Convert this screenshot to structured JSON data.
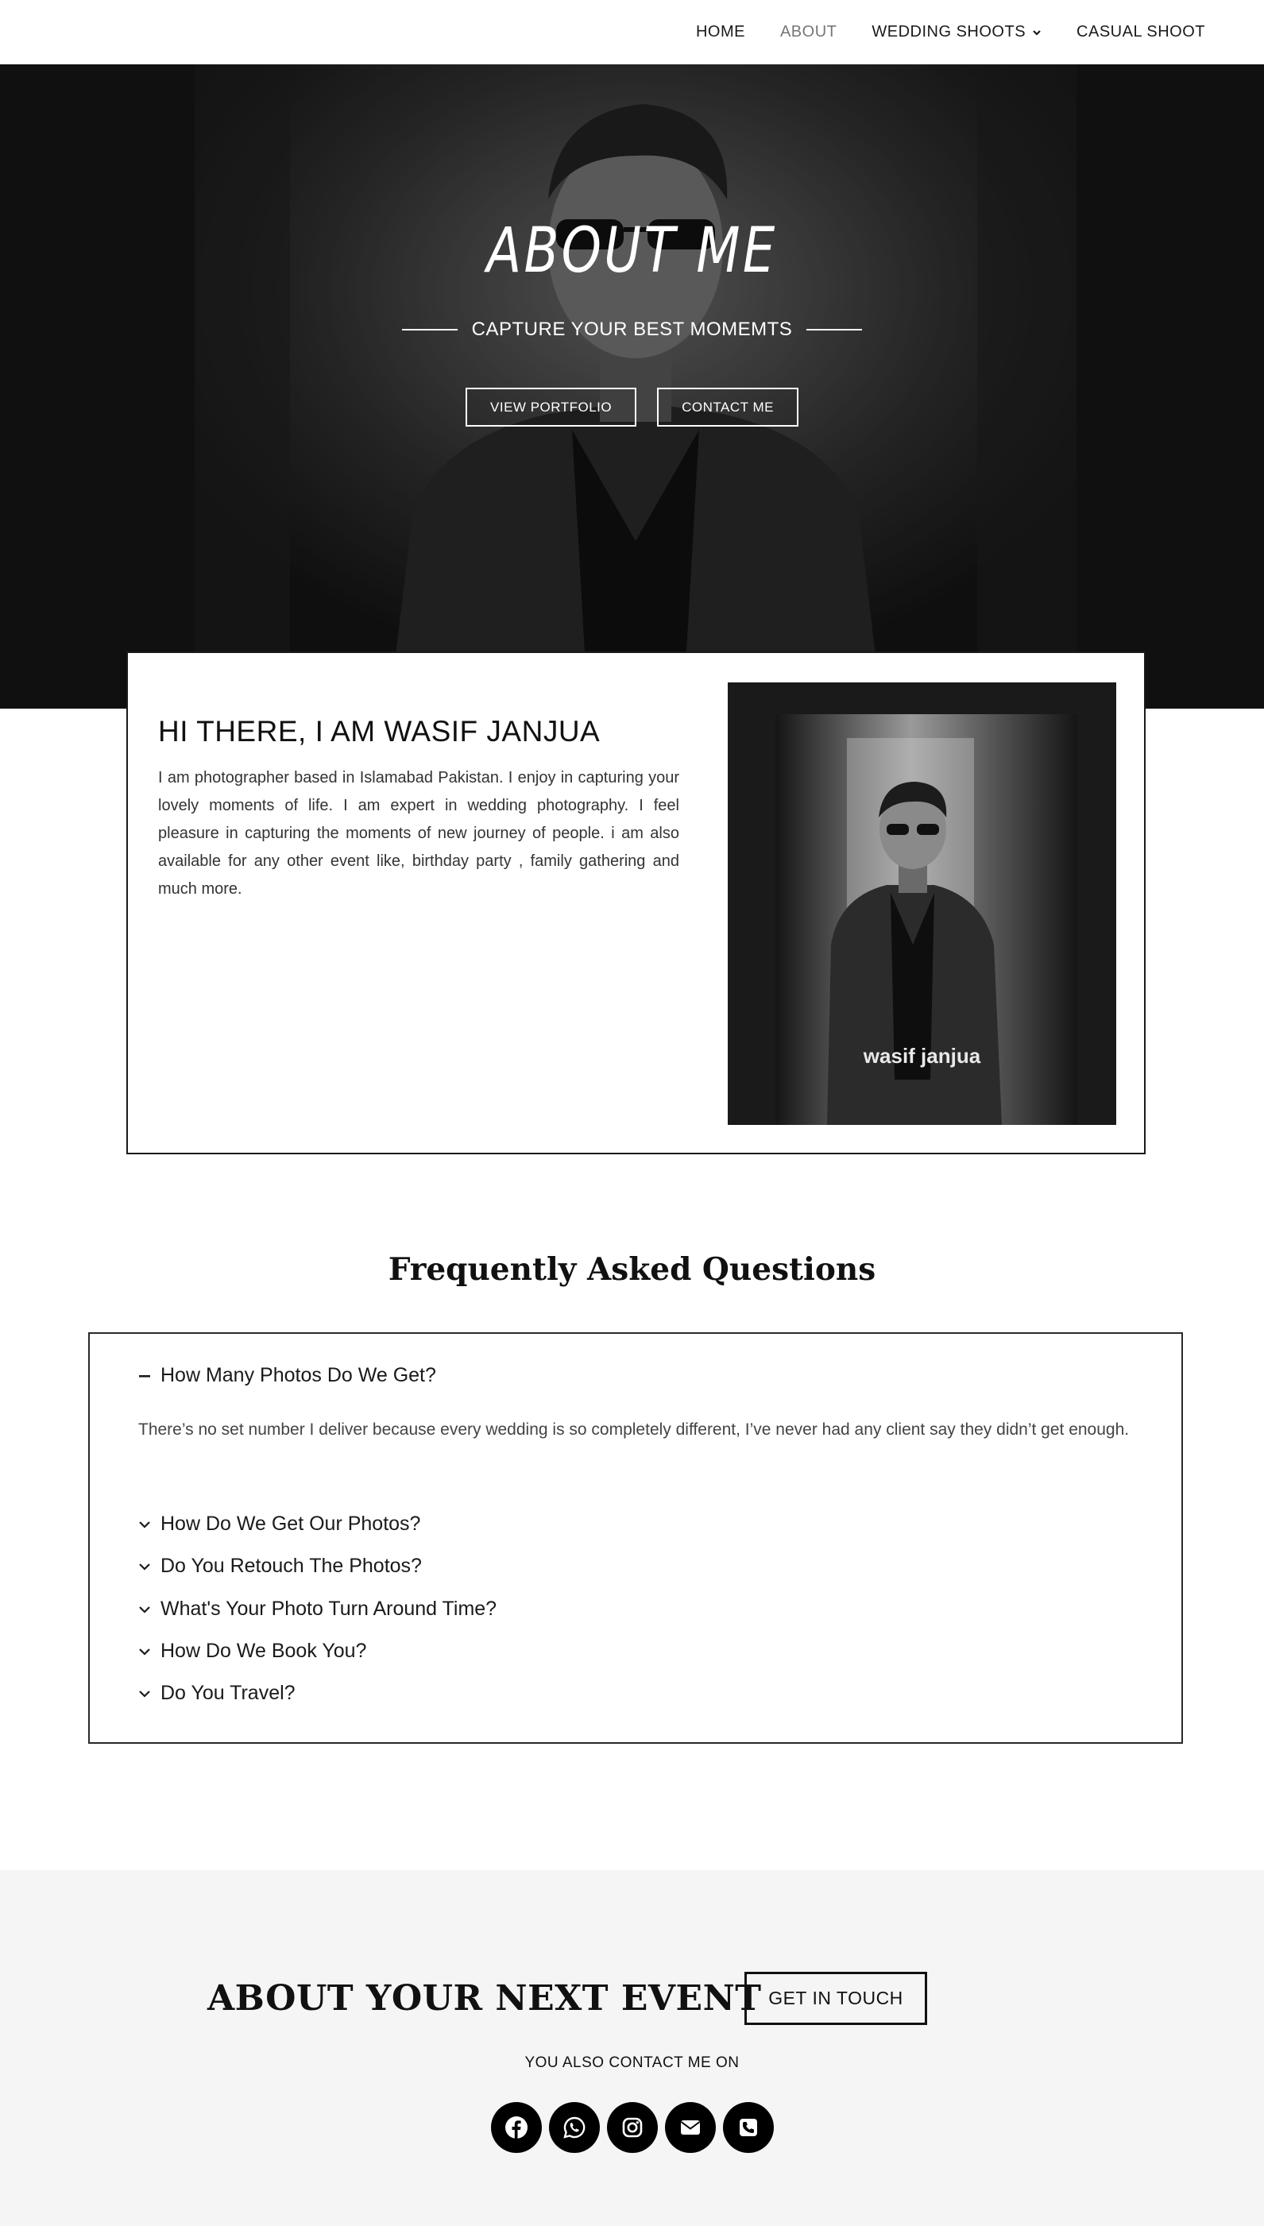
{
  "nav": {
    "items": [
      {
        "label": "HOME"
      },
      {
        "label": "ABOUT"
      },
      {
        "label": "WEDDING SHOOTS"
      },
      {
        "label": "CASUAL SHOOT"
      }
    ]
  },
  "hero": {
    "title": "ABOUT ME",
    "subtitle": "CAPTURE YOUR BEST MOMEMTS",
    "buttons": {
      "portfolio": "VIEW PORTFOLIO",
      "contact": "CONTACT ME"
    }
  },
  "about": {
    "heading": "HI THERE, I AM WASIF JANJUA",
    "text": "I am photographer based in Islamabad Pakistan. I enjoy in capturing your lovely moments of life.  I am expert in wedding photography. I feel pleasure in capturing the moments of new journey of people. i am also available for any other event like, birthday party , family gathering and much more.",
    "photo_caption": "wasif janjua"
  },
  "faq": {
    "title": "Frequently Asked Questions",
    "items": [
      {
        "question": "How Many Photos Do We Get?",
        "expanded": true,
        "answer": "There’s no set number I deliver because every wedding is so completely different, I’ve never had any client say they didn’t get enough."
      },
      {
        "question": "How Do We Get Our Photos?",
        "expanded": false
      },
      {
        "question": "Do You Retouch The Photos?",
        "expanded": false
      },
      {
        "question": "What's Your Photo Turn Around Time?",
        "expanded": false
      },
      {
        "question": "How Do We Book You?",
        "expanded": false
      },
      {
        "question": "Do You Travel?",
        "expanded": false
      }
    ]
  },
  "cta": {
    "heading": "ABOUT YOUR NEXT EVENT",
    "button": "GET IN TOUCH",
    "sub": "YOU ALSO CONTACT ME ON",
    "social": [
      "facebook-icon",
      "whatsapp-icon",
      "instagram-icon",
      "envelope-icon",
      "phone-icon"
    ]
  },
  "colors": {
    "primary": "#111111",
    "nav_active": "#777777",
    "cta_background": "#f5f5f5"
  }
}
